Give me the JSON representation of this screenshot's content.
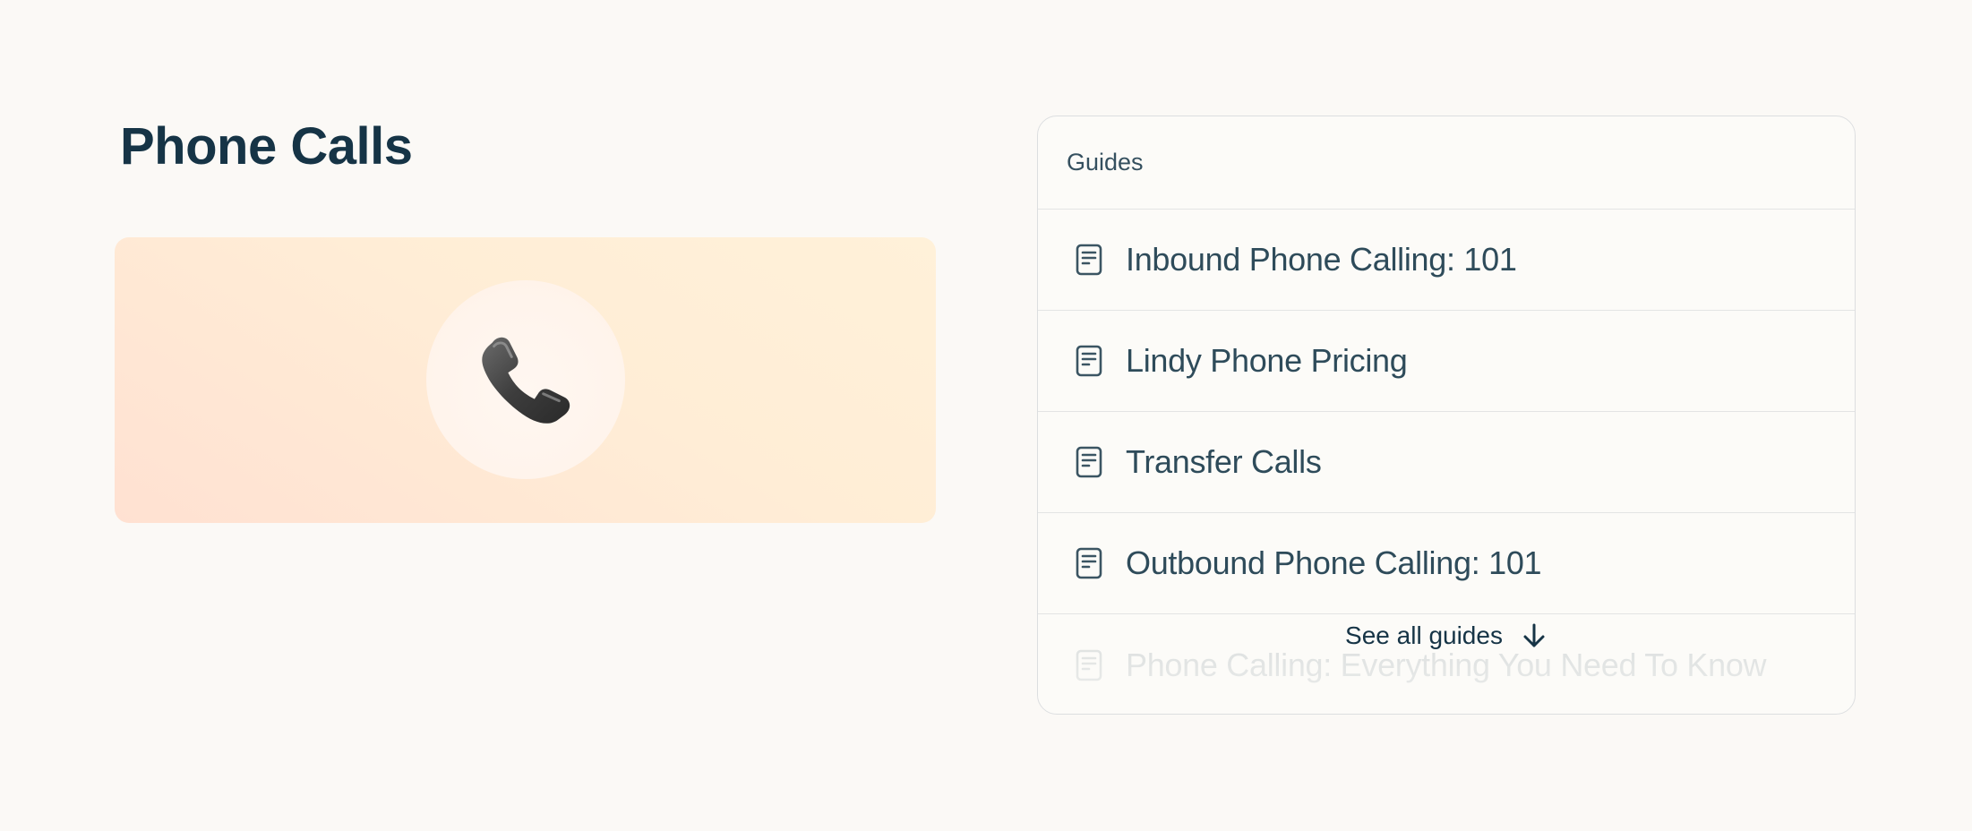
{
  "page": {
    "title": "Phone Calls",
    "hero_icon": "telephone-receiver-icon"
  },
  "guides": {
    "header": "Guides",
    "items": [
      {
        "label": "Inbound Phone Calling: 101",
        "icon": "document-icon"
      },
      {
        "label": "Lindy Phone Pricing",
        "icon": "document-icon"
      },
      {
        "label": "Transfer Calls",
        "icon": "document-icon"
      },
      {
        "label": "Outbound Phone Calling: 101",
        "icon": "document-icon"
      },
      {
        "label": "Phone Calling: Everything You Need To Know",
        "icon": "document-icon"
      }
    ],
    "see_all_label": "See all guides",
    "see_all_icon": "arrow-down-icon"
  },
  "colors": {
    "background": "#fbf9f6",
    "title": "#163446",
    "hero_gradient_start": "#fff1d9",
    "hero_gradient_end": "#ffe1d2",
    "card_border": "#dcdee0"
  }
}
